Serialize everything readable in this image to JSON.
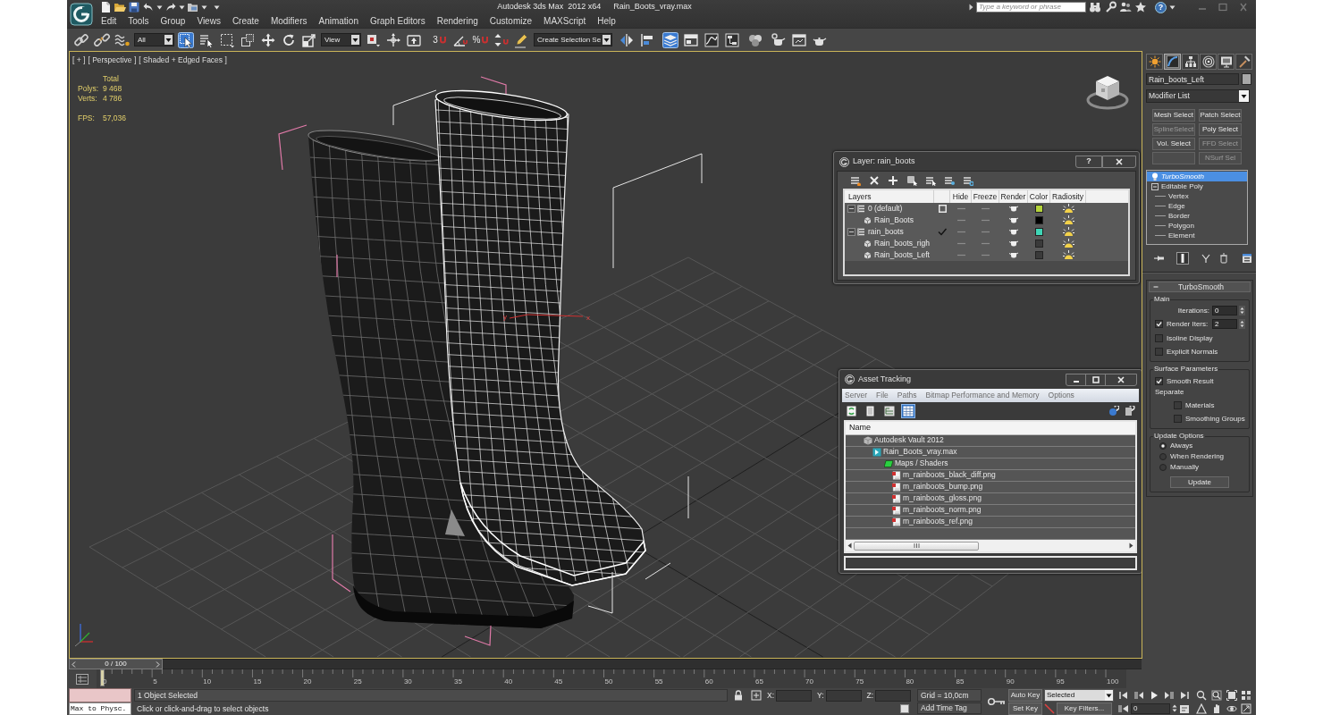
{
  "title_bar": {
    "title": "Autodesk 3ds Max  2012 x64",
    "file_name": "Rain_Boots_vray.max",
    "search": {
      "placeholder": "Type a keyword or phrase"
    },
    "help": "?"
  },
  "menu_bar": [
    "Edit",
    "Tools",
    "Group",
    "Views",
    "Create",
    "Modifiers",
    "Animation",
    "Graph Editors",
    "Rendering",
    "Customize",
    "MAXScript",
    "Help"
  ],
  "main_toolbar": [
    {
      "kind": "link",
      "selected": false
    },
    {
      "kind": "unlink",
      "selected": false
    },
    {
      "kind": "bind",
      "selected": false
    },
    {
      "kind": "dropdown",
      "value": "All"
    },
    {
      "kind": "select",
      "selected": true
    },
    {
      "kind": "select-by-name",
      "selected": false
    },
    {
      "kind": "region",
      "selected": false
    },
    {
      "kind": "crossing",
      "selected": false
    },
    {
      "kind": "move",
      "selected": false
    },
    {
      "kind": "rotate",
      "selected": false
    },
    {
      "kind": "scale",
      "selected": false
    },
    {
      "kind": "dropdown",
      "value": "View"
    },
    {
      "kind": "pivot",
      "selected": false
    },
    {
      "kind": "manipulate",
      "selected": false
    },
    {
      "kind": "keyboard",
      "selected": false
    },
    {
      "kind": "snap",
      "label": "3",
      "selected": false
    },
    {
      "kind": "angle-snap",
      "selected": false
    },
    {
      "kind": "percent-snap",
      "label": "%",
      "selected": false
    },
    {
      "kind": "spinner-snap",
      "selected": false
    },
    {
      "kind": "edit-named",
      "selected": false
    },
    {
      "kind": "dropdown",
      "value": "Create Selection Se"
    },
    {
      "kind": "mirror",
      "selected": false
    },
    {
      "kind": "align",
      "selected": false
    },
    {
      "kind": "layers",
      "selected": true
    },
    {
      "kind": "ribbon",
      "selected": false
    },
    {
      "kind": "curve-editor",
      "selected": false
    },
    {
      "kind": "schematic",
      "selected": false
    },
    {
      "kind": "material-editor",
      "selected": false
    },
    {
      "kind": "render-setup",
      "selected": false
    },
    {
      "kind": "frame-window",
      "selected": false
    },
    {
      "kind": "render",
      "selected": false
    }
  ],
  "viewport": {
    "active": true,
    "labels": [
      "[ + ]",
      "[ Perspective ]",
      "[ Shaded + Edged Faces ]"
    ],
    "stats": {
      "header": "Total",
      "rows": [
        {
          "label": "Polys:",
          "value": "9 468"
        },
        {
          "label": "Verts:",
          "value": "4 786"
        }
      ],
      "fps": {
        "label": "FPS:",
        "value": "57,036"
      }
    },
    "axis_labels": [
      "y",
      "x"
    ]
  },
  "layer_dialog": {
    "title": "Layer: rain_boots",
    "help": "?",
    "columns": [
      "Layers",
      "Hide",
      "Freeze",
      "Render",
      "Color",
      "Radiosity"
    ],
    "layers": [
      {
        "name": "0 (default)",
        "expanded": true,
        "current": false,
        "hidden": false,
        "frozen": false,
        "renderable": true,
        "color": "#b5d43b",
        "radiosity": true,
        "children": [
          {
            "name": "Rain_Boots",
            "hidden": false,
            "frozen": false,
            "renderable": true,
            "color": "#000000",
            "radiosity": true
          }
        ]
      },
      {
        "name": "rain_boots",
        "expanded": true,
        "current": true,
        "hidden": false,
        "frozen": false,
        "renderable": true,
        "color": "#3fd6b6",
        "radiosity": true,
        "children": [
          {
            "name": "Rain_boots_righ",
            "hidden": false,
            "frozen": false,
            "renderable": true,
            "color": "#3a3a3a",
            "radiosity": true
          },
          {
            "name": "Rain_boots_Left",
            "hidden": false,
            "frozen": false,
            "renderable": true,
            "color": "#3a3a3a",
            "radiosity": true
          }
        ]
      }
    ]
  },
  "asset_tracking": {
    "title": "Asset Tracking",
    "menu": [
      "Server",
      "File",
      "Paths",
      "Bitmap Performance and Memory",
      "Options"
    ],
    "toolbar": [
      {
        "kind": "refresh",
        "selected": false
      },
      {
        "kind": "list",
        "selected": false
      },
      {
        "kind": "tree",
        "selected": false
      },
      {
        "kind": "table",
        "selected": true
      }
    ],
    "column": "Name",
    "assets": [
      {
        "name": "Autodesk Vault 2012",
        "kind": "server",
        "children": [
          {
            "name": "Rain_Boots_vray.max",
            "kind": "scene",
            "children": [
              {
                "name": "Maps / Shaders",
                "kind": "folder",
                "children": [
                  {
                    "name": "m_rainboots_black_diff.png",
                    "kind": "bitmap"
                  },
                  {
                    "name": "m_rainboots_bump.png",
                    "kind": "bitmap"
                  },
                  {
                    "name": "m_rainboots_gloss.png",
                    "kind": "bitmap"
                  },
                  {
                    "name": "m_rainboots_norm.png",
                    "kind": "bitmap"
                  },
                  {
                    "name": "m_rainboots_ref.png",
                    "kind": "bitmap"
                  }
                ]
              }
            ]
          }
        ]
      }
    ]
  },
  "command_panel": {
    "tabs": [
      {
        "kind": "create",
        "selected": false
      },
      {
        "kind": "modify",
        "selected": true
      },
      {
        "kind": "hierarchy",
        "selected": false
      },
      {
        "kind": "motion",
        "selected": false
      },
      {
        "kind": "display",
        "selected": false
      },
      {
        "kind": "utilities",
        "selected": false
      }
    ],
    "object": {
      "name": "Rain_boots_Left",
      "color": "#a8a8a8"
    },
    "modifier_list": "Modifier List",
    "modifier_buttons": [
      {
        "kind": "set-button",
        "label": "Mesh Select",
        "disabled": false
      },
      {
        "kind": "set-button",
        "label": "Patch Select",
        "disabled": false
      },
      {
        "kind": "set-button",
        "label": "SplineSelect",
        "disabled": true
      },
      {
        "kind": "set-button",
        "label": "Poly Select",
        "disabled": false
      },
      {
        "kind": "set-button",
        "label": "Vol. Select",
        "disabled": false
      },
      {
        "kind": "set-button",
        "label": "FFD Select",
        "disabled": true
      },
      {
        "kind": "empty"
      },
      {
        "kind": "set-button",
        "label": "NSurf Sel",
        "disabled": true
      }
    ],
    "modifier_stack": [
      {
        "kind": "modifier",
        "name": "TurboSmooth",
        "on": true,
        "selected": true
      },
      {
        "kind": "base",
        "name": "Editable Poly",
        "expanded": true,
        "selected": false,
        "children": [
          {
            "name": "Vertex",
            "selected": false
          },
          {
            "name": "Edge",
            "selected": false
          },
          {
            "name": "Border",
            "selected": false
          },
          {
            "name": "Polygon",
            "selected": false
          },
          {
            "name": "Element",
            "selected": false
          }
        ]
      }
    ],
    "stack_tools": [
      {
        "kind": "pin",
        "selected": false
      },
      {
        "kind": "end-result",
        "selected": true
      },
      {
        "kind": "make-unique",
        "selected": false
      },
      {
        "kind": "remove",
        "selected": false
      },
      {
        "kind": "configure",
        "selected": false
      }
    ],
    "rollout": {
      "title": "TurboSmooth",
      "expanded": true,
      "groups": [
        {
          "title": "Main",
          "controls": [
            {
              "kind": "spinner",
              "label": "Iterations:",
              "value": "0"
            },
            {
              "kind": "checkbox-spinner",
              "label": "Render Iters:",
              "checked": true,
              "value": "2"
            },
            {
              "kind": "checkbox",
              "label": "Isoline Display",
              "checked": false
            },
            {
              "kind": "checkbox",
              "label": "Explicit Normals",
              "checked": false
            }
          ]
        },
        {
          "title": "Surface Parameters",
          "controls": [
            {
              "kind": "checkbox",
              "label": "Smooth Result",
              "checked": true
            },
            {
              "kind": "label",
              "label": "Separate",
              "children": [
                {
                  "kind": "checkbox",
                  "label": "Materials",
                  "checked": false
                },
                {
                  "kind": "checkbox",
                  "label": "Smoothing Groups",
                  "checked": false
                }
              ]
            }
          ]
        },
        {
          "title": "Update Options",
          "controls": [
            {
              "kind": "radio",
              "label": "Always",
              "selected": true
            },
            {
              "kind": "radio",
              "label": "When Rendering",
              "selected": false
            },
            {
              "kind": "radio",
              "label": "Manually",
              "selected": false
            },
            {
              "kind": "button",
              "label": "Update"
            }
          ]
        }
      ]
    }
  },
  "timeline": {
    "frame": "0 / 100",
    "level": 0,
    "ticks": [
      "0",
      "5",
      "10",
      "15",
      "20",
      "25",
      "30",
      "35",
      "40",
      "45",
      "50",
      "55",
      "60",
      "65",
      "70",
      "75",
      "80",
      "85",
      "90",
      "95",
      "100"
    ]
  },
  "status_bar": {
    "listener_input": "Max to Physc.",
    "selection": "1 Object Selected",
    "prompt": "Click or click-and-drag to select objects",
    "coords": [
      {
        "label": "X:"
      },
      {
        "label": "Y:"
      },
      {
        "label": "Z:"
      }
    ],
    "grid": "Grid = 10,0cm",
    "time_tag": "Add Time Tag",
    "auto_key": "Auto Key",
    "key_mode": "Selected",
    "set_key": "Set Key",
    "key_filters": "Key Filters...",
    "current_frame": "0"
  }
}
